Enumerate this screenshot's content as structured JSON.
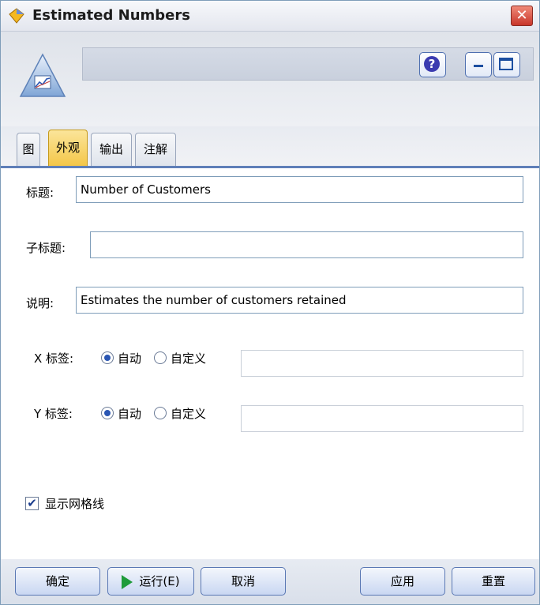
{
  "window": {
    "title": "Estimated Numbers",
    "close_glyph": "✕"
  },
  "header": {
    "help_glyph": "?"
  },
  "tabs": [
    "图",
    "外观",
    "输出",
    "注解"
  ],
  "active_tab": 1,
  "form": {
    "title_label": "标题:",
    "title_value": "Number of Customers",
    "subtitle_label": "子标题:",
    "subtitle_value": "",
    "caption_label": "说明:",
    "caption_value": "Estimates the number of customers retained",
    "x_label": "X 标签:",
    "y_label": "Y 标签:",
    "auto": "自动",
    "custom": "自定义",
    "x_mode": "auto",
    "y_mode": "auto",
    "x_custom_value": "",
    "y_custom_value": "",
    "show_grid_label": "显示网格线",
    "show_grid": true,
    "check_glyph": "✔"
  },
  "buttons": {
    "ok": "确定",
    "run": "运行(E)",
    "cancel": "取消",
    "apply": "应用",
    "reset": "重置"
  },
  "colors": {
    "active_tab": "#f4c545",
    "tab_rule": "#5f7fb8",
    "run_icon": "#1e9b3a"
  }
}
